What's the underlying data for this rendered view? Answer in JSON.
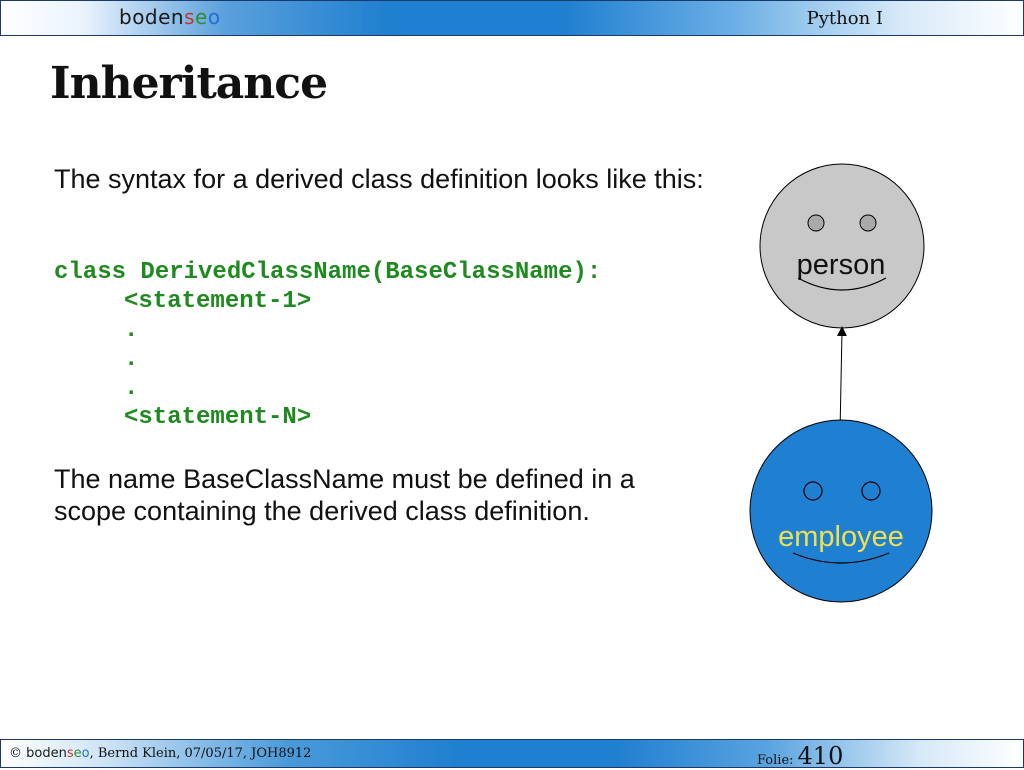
{
  "header": {
    "logo_parts": [
      "boden",
      "s",
      "e",
      "o"
    ],
    "course": "Python I"
  },
  "slide": {
    "title": "Inheritance",
    "intro": "The syntax for a derived class definition looks like this:",
    "code": {
      "first_line": "class DerivedClassName(BaseClassName):",
      "body_lines": [
        "<statement-1>",
        ".",
        ".",
        ".",
        "<statement-N>"
      ]
    },
    "note": "The name BaseClassName must be defined in a scope containing the derived class definition."
  },
  "diagram": {
    "parent_label": "person",
    "child_label": "employee",
    "parent_color": "#c8c8c8",
    "child_color": "#1f7fd0",
    "child_label_color": "#f0e050"
  },
  "footer": {
    "copyright_symbol": "©",
    "logo_parts": [
      "boden",
      "s",
      "e",
      "o"
    ],
    "author_info": ", Bernd Klein, 07/05/17, JOH8912",
    "slide_label": "Folie:",
    "slide_number": "410"
  }
}
